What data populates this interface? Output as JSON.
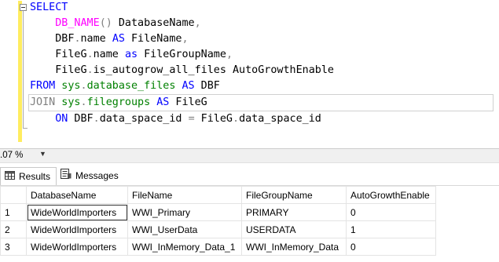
{
  "editor": {
    "lines": [
      {
        "tokens": [
          {
            "t": "SELECT",
            "c": "kw"
          }
        ]
      },
      {
        "tokens": [
          {
            "t": "    "
          },
          {
            "t": "DB_NAME",
            "c": "fn"
          },
          {
            "t": "() ",
            "c": "gray"
          },
          {
            "t": "DatabaseName",
            "c": "txt"
          },
          {
            "t": ",",
            "c": "gray"
          }
        ]
      },
      {
        "tokens": [
          {
            "t": "    DBF",
            "c": "txt"
          },
          {
            "t": ".",
            "c": "gray"
          },
          {
            "t": "name ",
            "c": "txt"
          },
          {
            "t": "AS",
            "c": "kw"
          },
          {
            "t": " FileName",
            "c": "txt"
          },
          {
            "t": ",",
            "c": "gray"
          }
        ]
      },
      {
        "tokens": [
          {
            "t": "    FileG",
            "c": "txt"
          },
          {
            "t": ".",
            "c": "gray"
          },
          {
            "t": "name ",
            "c": "txt"
          },
          {
            "t": "as",
            "c": "kw"
          },
          {
            "t": " FileGroupName",
            "c": "txt"
          },
          {
            "t": ",",
            "c": "gray"
          }
        ]
      },
      {
        "tokens": [
          {
            "t": "    FileG",
            "c": "txt"
          },
          {
            "t": ".",
            "c": "gray"
          },
          {
            "t": "is_autogrow_all_files AutoGrowthEnable",
            "c": "txt"
          }
        ]
      },
      {
        "tokens": [
          {
            "t": "FROM",
            "c": "kw"
          },
          {
            "t": " sys",
            "c": "sys"
          },
          {
            "t": ".",
            "c": "gray"
          },
          {
            "t": "database_files",
            "c": "sys"
          },
          {
            "t": " ",
            "c": "txt"
          },
          {
            "t": "AS",
            "c": "kw"
          },
          {
            "t": " DBF",
            "c": "txt"
          }
        ]
      },
      {
        "tokens": [
          {
            "t": "JOIN",
            "c": "gray"
          },
          {
            "t": " sys",
            "c": "sys"
          },
          {
            "t": ".",
            "c": "gray"
          },
          {
            "t": "filegroups",
            "c": "sys"
          },
          {
            "t": " ",
            "c": "txt"
          },
          {
            "t": "AS",
            "c": "kw"
          },
          {
            "t": " FileG",
            "c": "txt"
          }
        ]
      },
      {
        "tokens": [
          {
            "t": "    "
          },
          {
            "t": "ON",
            "c": "kw"
          },
          {
            "t": " DBF",
            "c": "txt"
          },
          {
            "t": ".",
            "c": "gray"
          },
          {
            "t": "data_space_id ",
            "c": "txt"
          },
          {
            "t": "=",
            "c": "gray"
          },
          {
            "t": " FileG",
            "c": "txt"
          },
          {
            "t": ".",
            "c": "gray"
          },
          {
            "t": "data_space_id",
            "c": "txt"
          }
        ]
      }
    ]
  },
  "zoom": {
    "value": ".07 %"
  },
  "tabs": {
    "results": "Results",
    "messages": "Messages"
  },
  "grid": {
    "columns": [
      "DatabaseName",
      "FileName",
      "FileGroupName",
      "AutoGrowthEnable"
    ],
    "rows": [
      {
        "n": "1",
        "cells": [
          "WideWorldImporters",
          "WWI_Primary",
          "PRIMARY",
          "0"
        ]
      },
      {
        "n": "2",
        "cells": [
          "WideWorldImporters",
          "WWI_UserData",
          "USERDATA",
          "1"
        ]
      },
      {
        "n": "3",
        "cells": [
          "WideWorldImporters",
          "WWI_InMemory_Data_1",
          "WWI_InMemory_Data",
          "0"
        ]
      }
    ]
  },
  "colors": {
    "keyword": "#0000ff",
    "function": "#ff00ff",
    "system": "#008000",
    "operator": "#808080",
    "change_bar": "#ffec60"
  }
}
